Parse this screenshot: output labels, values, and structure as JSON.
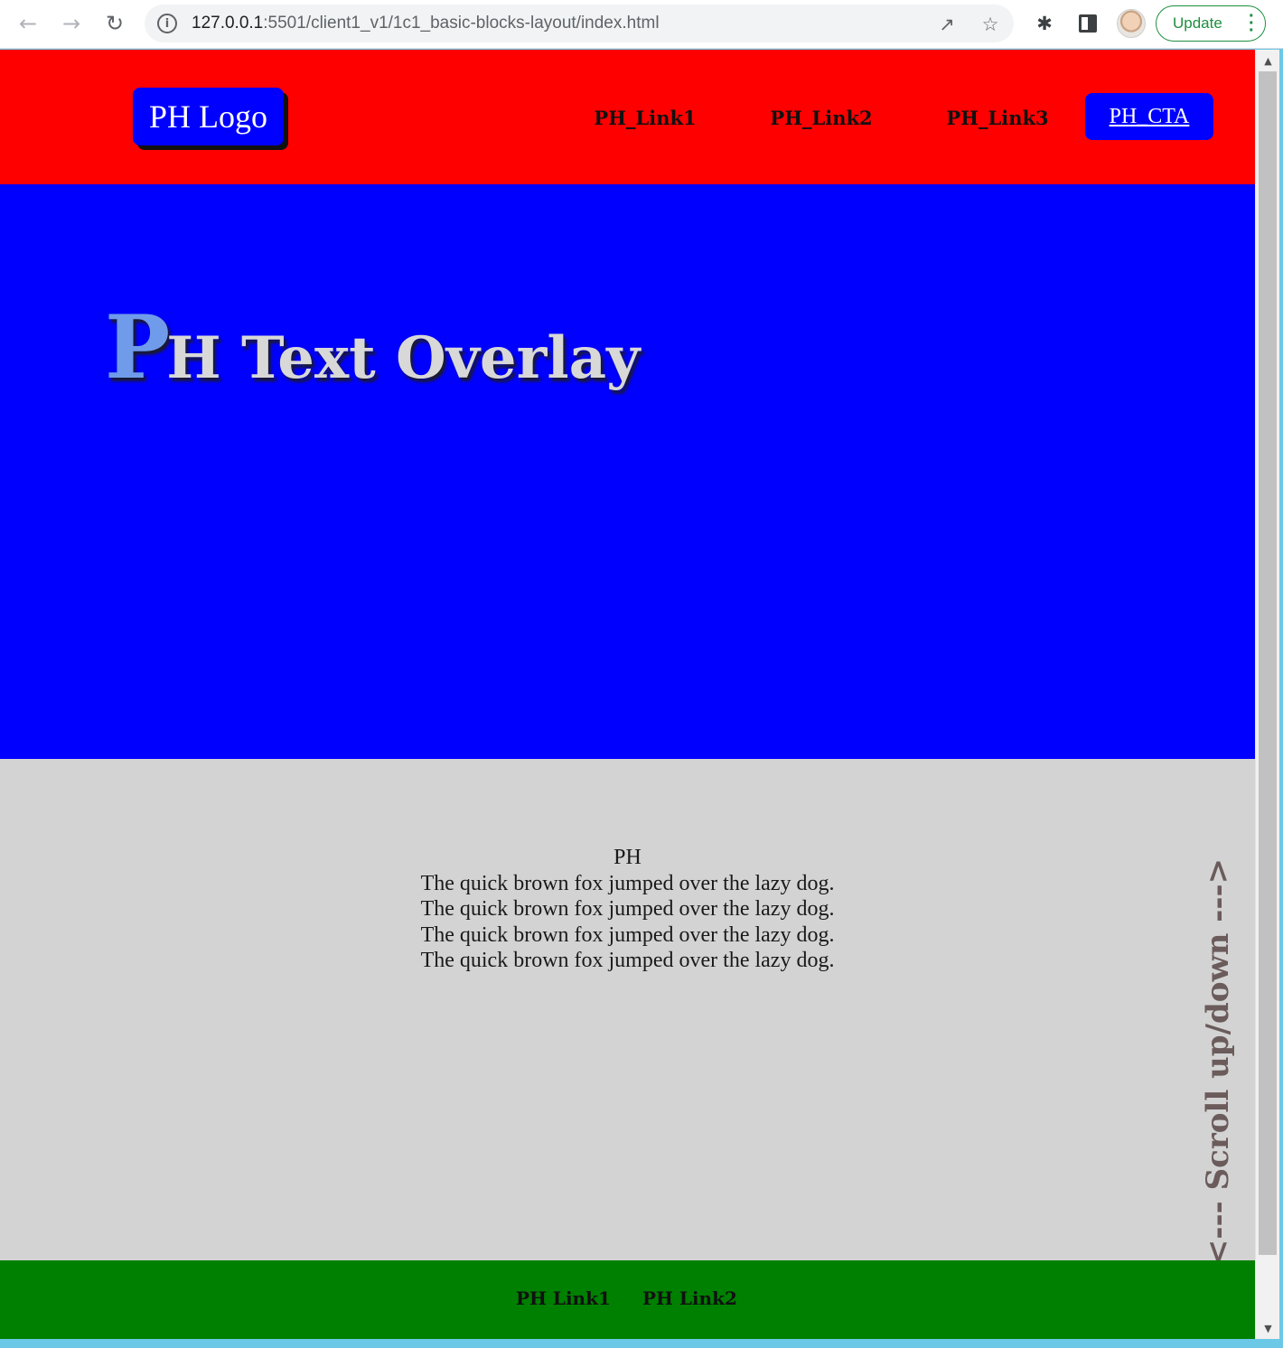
{
  "browser": {
    "url_host": "127.0.0.1",
    "url_path": ":5501/client1_v1/1c1_basic-blocks-layout/index.html",
    "update_label": "Update",
    "icons": {
      "back": "arrow-left-icon",
      "forward": "arrow-right-icon",
      "reload": "reload-icon",
      "info": "info-icon",
      "share": "share-icon",
      "bookmark": "star-icon",
      "extensions": "puzzle-icon",
      "side_panel": "side-panel-icon",
      "menu": "kebab-menu-icon"
    }
  },
  "header": {
    "logo": "PH Logo",
    "links": [
      "PH_Link1",
      "PH_Link2",
      "PH_Link3"
    ],
    "cta": "PH_CTA",
    "bg_color": "#ff0000"
  },
  "hero": {
    "title_cap": "P",
    "title_rest": "H Text Overlay",
    "bg_color": "#0000ff"
  },
  "content": {
    "heading": "PH",
    "lines": [
      "The quick brown fox jumped over the lazy dog.",
      "The quick brown fox jumped over the lazy dog.",
      "The quick brown fox jumped over the lazy dog.",
      "The quick brown fox jumped over the lazy dog."
    ],
    "scroll_hint": "<--- Scroll up/down --->",
    "bg_color": "#d3d3d3"
  },
  "footer": {
    "links": [
      "PH Link1",
      "PH Link2"
    ],
    "bg_color": "#008000"
  }
}
